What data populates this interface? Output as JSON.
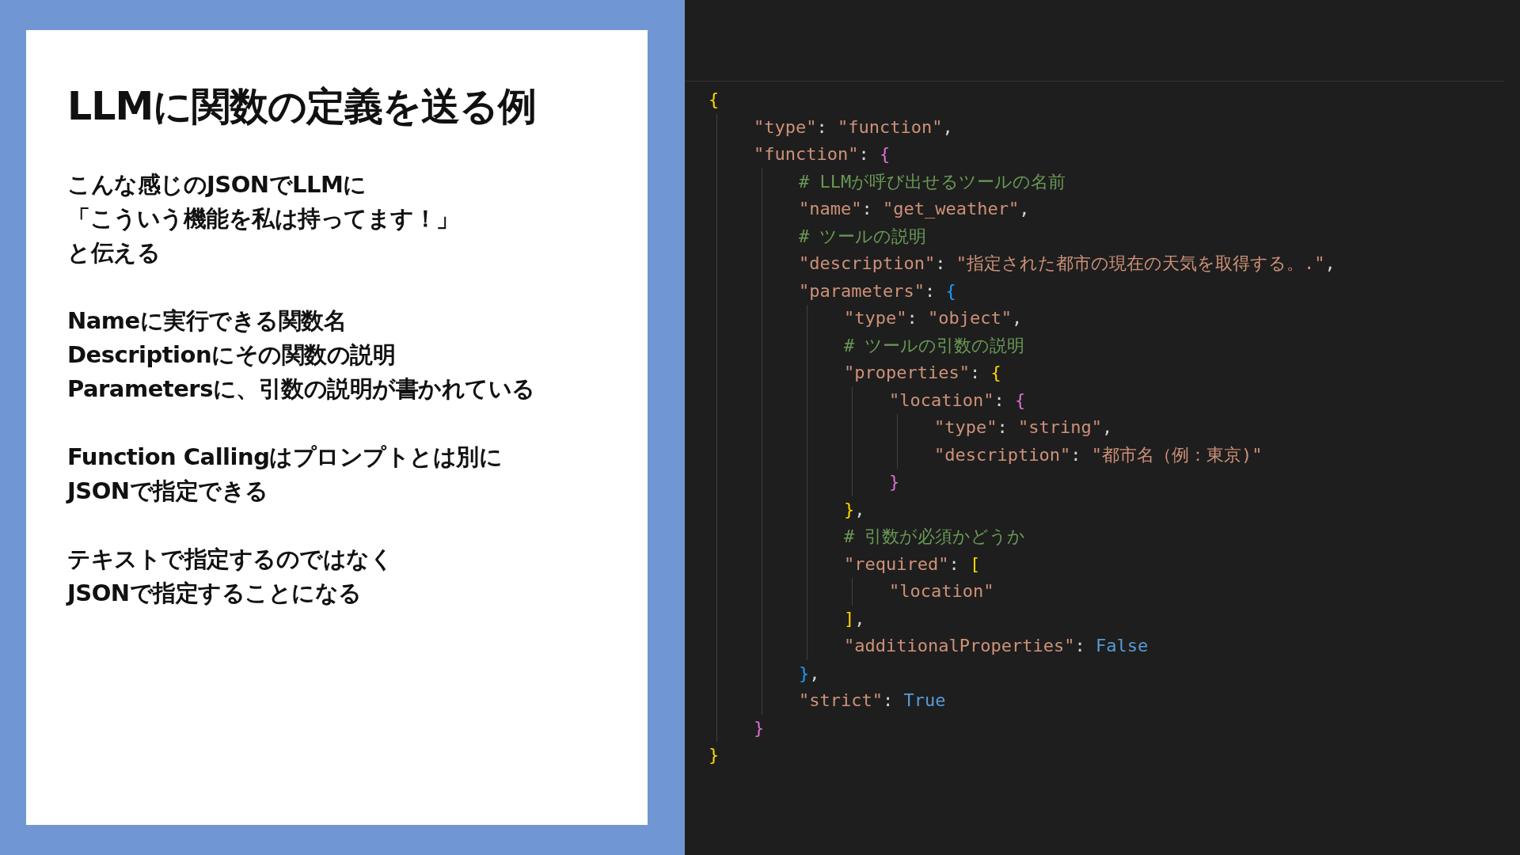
{
  "slide": {
    "title": "LLMに関数の定義を送る例",
    "paragraphs": [
      {
        "lines": [
          "こんな感じのJSONでLLMに",
          "「こういう機能を私は持ってます！」",
          "と伝える"
        ]
      },
      {
        "lines": [
          "Nameに実行できる関数名",
          "Descriptionにその関数の説明",
          "Parametersに、引数の説明が書かれている"
        ]
      },
      {
        "lines": [
          "Function Callingはプロンプトとは別に",
          "JSONで指定できる"
        ]
      },
      {
        "lines": [
          "テキストで指定するのではなく",
          "JSONで指定することになる"
        ]
      }
    ]
  },
  "code": {
    "lines": [
      {
        "tokens": [
          {
            "kind": "gold",
            "text": "{"
          }
        ],
        "children": [
          {
            "tokens": [
              {
                "kind": "key",
                "text": "\"type\""
              },
              {
                "kind": "punct",
                "text": ": "
              },
              {
                "kind": "string",
                "text": "\"function\""
              },
              {
                "kind": "punct",
                "text": ","
              }
            ]
          },
          {
            "tokens": [
              {
                "kind": "key",
                "text": "\"function\""
              },
              {
                "kind": "punct",
                "text": ": "
              },
              {
                "kind": "pink",
                "text": "{"
              }
            ],
            "children": [
              {
                "tokens": [
                  {
                    "kind": "comment",
                    "text": "# LLMが呼び出せるツールの名前"
                  }
                ]
              },
              {
                "tokens": [
                  {
                    "kind": "key",
                    "text": "\"name\""
                  },
                  {
                    "kind": "punct",
                    "text": ": "
                  },
                  {
                    "kind": "string",
                    "text": "\"get_weather\""
                  },
                  {
                    "kind": "punct",
                    "text": ","
                  }
                ]
              },
              {
                "tokens": [
                  {
                    "kind": "comment",
                    "text": "# ツールの説明"
                  }
                ]
              },
              {
                "tokens": [
                  {
                    "kind": "key",
                    "text": "\"description\""
                  },
                  {
                    "kind": "punct",
                    "text": ": "
                  },
                  {
                    "kind": "string",
                    "text": "\"指定された都市の現在の天気を取得する。.\""
                  },
                  {
                    "kind": "punct",
                    "text": ","
                  }
                ]
              },
              {
                "tokens": [
                  {
                    "kind": "key",
                    "text": "\"parameters\""
                  },
                  {
                    "kind": "punct",
                    "text": ": "
                  },
                  {
                    "kind": "blue",
                    "text": "{"
                  }
                ],
                "children": [
                  {
                    "tokens": [
                      {
                        "kind": "key",
                        "text": "\"type\""
                      },
                      {
                        "kind": "punct",
                        "text": ": "
                      },
                      {
                        "kind": "string",
                        "text": "\"object\""
                      },
                      {
                        "kind": "punct",
                        "text": ","
                      }
                    ]
                  },
                  {
                    "tokens": [
                      {
                        "kind": "comment",
                        "text": "# ツールの引数の説明"
                      }
                    ]
                  },
                  {
                    "tokens": [
                      {
                        "kind": "key",
                        "text": "\"properties\""
                      },
                      {
                        "kind": "punct",
                        "text": ": "
                      },
                      {
                        "kind": "gold",
                        "text": "{"
                      }
                    ],
                    "children": [
                      {
                        "tokens": [
                          {
                            "kind": "key",
                            "text": "\"location\""
                          },
                          {
                            "kind": "punct",
                            "text": ": "
                          },
                          {
                            "kind": "pink",
                            "text": "{"
                          }
                        ],
                        "children": [
                          {
                            "tokens": [
                              {
                                "kind": "key",
                                "text": "\"type\""
                              },
                              {
                                "kind": "punct",
                                "text": ": "
                              },
                              {
                                "kind": "string",
                                "text": "\"string\""
                              },
                              {
                                "kind": "punct",
                                "text": ","
                              }
                            ]
                          },
                          {
                            "tokens": [
                              {
                                "kind": "key",
                                "text": "\"description\""
                              },
                              {
                                "kind": "punct",
                                "text": ": "
                              },
                              {
                                "kind": "string",
                                "text": "\"都市名（例：東京)\""
                              }
                            ]
                          }
                        ]
                      },
                      {
                        "tokens": [
                          {
                            "kind": "pink",
                            "text": "}"
                          }
                        ]
                      }
                    ]
                  },
                  {
                    "tokens": [
                      {
                        "kind": "gold",
                        "text": "}"
                      },
                      {
                        "kind": "punct",
                        "text": ","
                      }
                    ]
                  },
                  {
                    "tokens": [
                      {
                        "kind": "comment",
                        "text": "# 引数が必須かどうか"
                      }
                    ]
                  },
                  {
                    "tokens": [
                      {
                        "kind": "key",
                        "text": "\"required\""
                      },
                      {
                        "kind": "punct",
                        "text": ": "
                      },
                      {
                        "kind": "gold",
                        "text": "["
                      }
                    ],
                    "children": [
                      {
                        "tokens": [
                          {
                            "kind": "string",
                            "text": "\"location\""
                          }
                        ]
                      }
                    ]
                  },
                  {
                    "tokens": [
                      {
                        "kind": "gold",
                        "text": "]"
                      },
                      {
                        "kind": "punct",
                        "text": ","
                      }
                    ]
                  },
                  {
                    "tokens": [
                      {
                        "kind": "key",
                        "text": "\"additionalProperties\""
                      },
                      {
                        "kind": "punct",
                        "text": ": "
                      },
                      {
                        "kind": "constant",
                        "text": "False"
                      }
                    ]
                  }
                ]
              },
              {
                "tokens": [
                  {
                    "kind": "blue",
                    "text": "}"
                  },
                  {
                    "kind": "punct",
                    "text": ","
                  }
                ]
              },
              {
                "tokens": [
                  {
                    "kind": "key",
                    "text": "\"strict\""
                  },
                  {
                    "kind": "punct",
                    "text": ": "
                  },
                  {
                    "kind": "constant",
                    "text": "True"
                  }
                ]
              }
            ]
          },
          {
            "tokens": [
              {
                "kind": "pink",
                "text": "}"
              }
            ]
          }
        ]
      },
      {
        "tokens": [
          {
            "kind": "gold",
            "text": "}"
          }
        ]
      }
    ]
  }
}
